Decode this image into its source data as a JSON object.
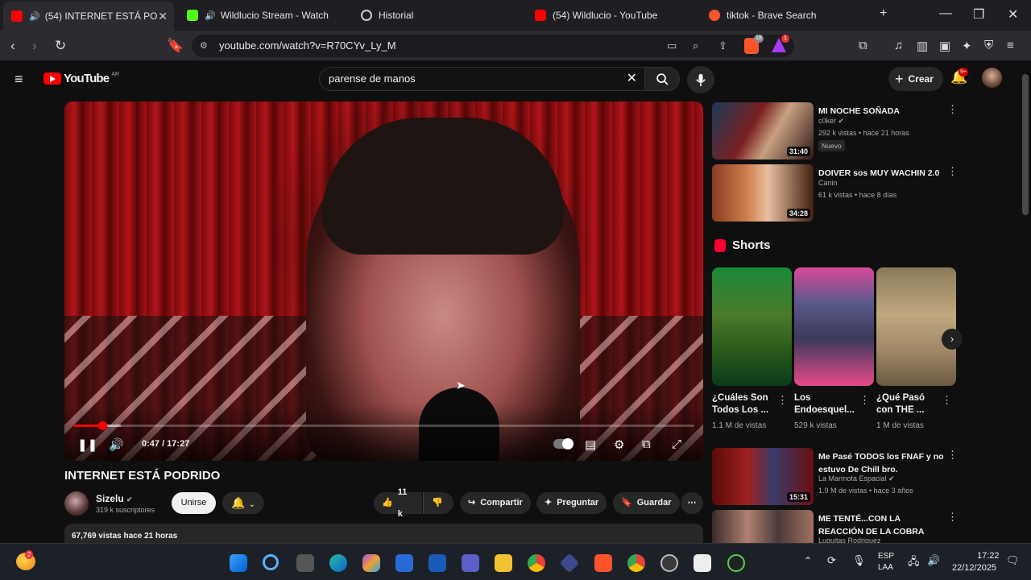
{
  "browser": {
    "tabs": [
      {
        "title": "(54) INTERNET ESTÁ PODRIDO - YouTube",
        "active": true
      },
      {
        "title": "Wildlucio Stream - Watch Live"
      },
      {
        "title": "Historial"
      },
      {
        "title": "(54) Wildlucio - YouTube"
      },
      {
        "title": "tiktok - Brave Search"
      }
    ],
    "url": "youtube.com/watch?v=R70CYv_Ly_M",
    "shields_count": "18",
    "rewards_count": "1"
  },
  "youtube": {
    "logo_text": "YouTube",
    "region": "AR",
    "search_value": "parense de manos",
    "create_label": "Crear",
    "notif_count": "9+"
  },
  "player": {
    "time": "0:47 / 17:27",
    "progress_fraction": 0.045,
    "buffered_fraction": 0.075
  },
  "video": {
    "title": "INTERNET ESTÁ PODRIDO",
    "channel": "Sizelu",
    "subscribers": "319 k suscriptores",
    "join_label": "Unirse",
    "likes": "11 k",
    "share_label": "Compartir",
    "ask_label": "Preguntar",
    "save_label": "Guardar",
    "description_meta": "67,769 vistas  hace 21 horas"
  },
  "recommendations_top": [
    {
      "title": "MI NOCHE SOÑADA",
      "channel": "c0ker",
      "meta": "292 k vistas • hace 21 horas",
      "badge": "Nuevo",
      "duration": "31:40"
    },
    {
      "title": "DOIVER sos MUY WACHIN 2.0",
      "channel": "Canin",
      "meta": "61 k vistas • hace 8 días",
      "duration": "34:28"
    }
  ],
  "shorts": {
    "heading": "Shorts",
    "items": [
      {
        "title": "¿Cuáles Son Todos Los ...",
        "views": "1.1 M de vistas"
      },
      {
        "title": "Los Endoesquel...",
        "views": "529 k vistas"
      },
      {
        "title": "¿Qué Pasó con THE ...",
        "views": "1 M de vistas"
      }
    ]
  },
  "recommendations_bottom": [
    {
      "title": "Me Pasé TODOS los FNAF y no estuvo De Chill bro.",
      "channel": "La Marmota Espacial",
      "meta": "1.9 M de vistas • hace 3 años",
      "duration": "15:31"
    },
    {
      "title": "ME TENTÉ...CON LA REACCIÓN DE LA COBRA",
      "channel": "Luquitas Rodriguez"
    }
  ],
  "taskbar": {
    "weather_badge": "2",
    "lang_top": "ESP",
    "lang_bottom": "LAA",
    "time": "17:22",
    "date": "22/12/2025"
  }
}
